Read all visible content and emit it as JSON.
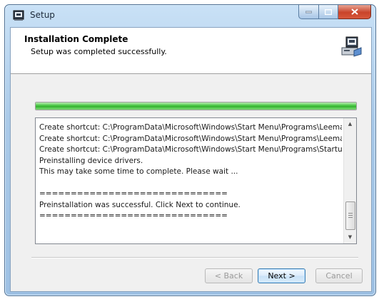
{
  "window": {
    "title": "Setup"
  },
  "header": {
    "title": "Installation Complete",
    "subtitle": "Setup was completed successfully."
  },
  "progress": {
    "percent": 100,
    "color": "#37c134"
  },
  "log": {
    "lines": [
      "Create shortcut: C:\\ProgramData\\Microsoft\\Windows\\Start Menu\\Programs\\Leema A...",
      "Create shortcut: C:\\ProgramData\\Microsoft\\Windows\\Start Menu\\Programs\\Leema A...",
      "Create shortcut: C:\\ProgramData\\Microsoft\\Windows\\Start Menu\\Programs\\Startup\\...",
      "Preinstalling device drivers.",
      "This may take some time to complete. Please wait ...",
      "",
      "==============================",
      "Preinstallation was successful. Click Next to continue.",
      "=============================="
    ]
  },
  "buttons": {
    "back": "< Back",
    "next": "Next >",
    "cancel": "Cancel"
  },
  "icons": {
    "app": "setup-app-icon",
    "header": "installer-computer-icon"
  }
}
